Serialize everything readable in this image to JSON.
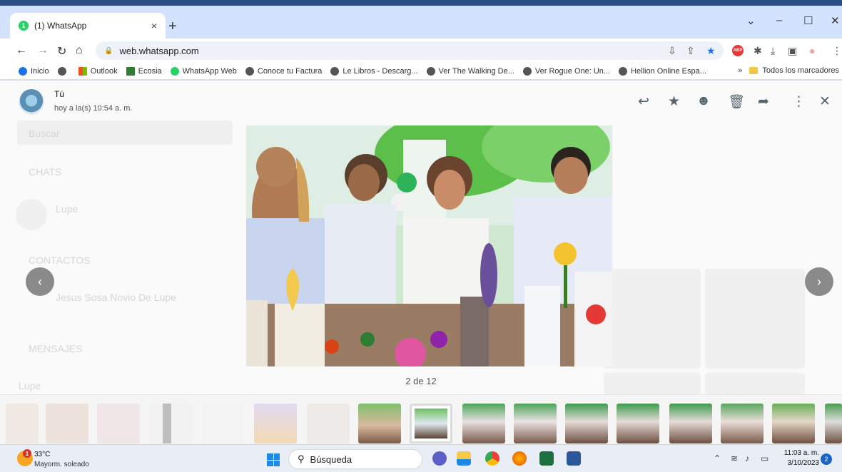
{
  "browser": {
    "tab_title": "(1) WhatsApp",
    "tab_badge": "1",
    "tab_close": "×",
    "new_tab": "+",
    "window_controls": [
      "⌄",
      "–",
      "☐",
      "✕"
    ],
    "url": "web.whatsapp.com",
    "bookmarks": [
      "Inicio",
      "Outlook",
      "Ecosia",
      "WhatsApp Web",
      "Conoce tu Factura",
      "Le Libros - Descarg...",
      "Ver The Walking De...",
      "Ver Rogue One: Un...",
      "Hellion Online Espa..."
    ],
    "bookmarks_overflow": "»",
    "all_bookmarks": "Todos los marcadores",
    "extension_abp": "ABP"
  },
  "viewer": {
    "sender_name": "Tú",
    "sender_time": "hoy a la(s) 10:54 a. m.",
    "counter": "2 de 12",
    "prev_arrow": "‹",
    "next_arrow": "›",
    "toolbar_icons": [
      "reply-icon",
      "star-icon",
      "emoji-icon",
      "delete-icon",
      "forward-icon",
      "more-icon",
      "close-icon"
    ],
    "background_ghost_text": {
      "search": "Buscar",
      "chats": "CHATS",
      "chat_name": "Lupe",
      "contacts": "CONTACTOS",
      "contact_name": "Jesus Sosa Novio De Lupe",
      "messages": "MENSAJES",
      "message_name": "Lupe"
    },
    "thumbnail_count": 17
  },
  "colors": {
    "accent": "#25d366",
    "tab_bar": "#d3e3fd",
    "icon_gray": "#54656f"
  },
  "taskbar": {
    "weather_temp": "33°C",
    "weather_desc": "Mayorm. soleado",
    "weather_badge": "1",
    "search_placeholder": "Búsqueda",
    "time": "11:03 a. m.",
    "date": "3/10/2023",
    "notification_count": "2"
  }
}
